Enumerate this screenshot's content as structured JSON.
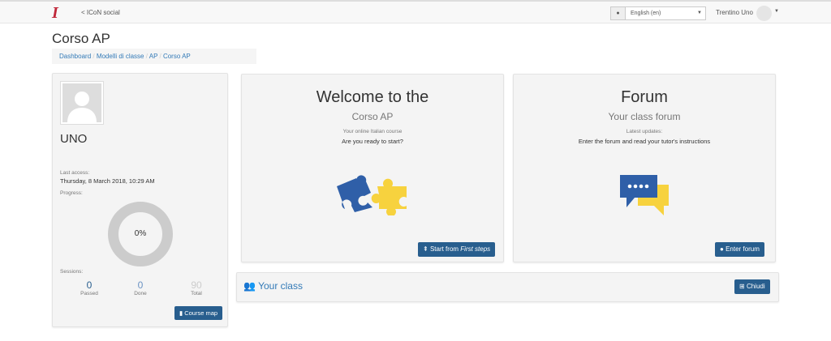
{
  "nav": {
    "logo": "I",
    "social": "ICoN social",
    "language": "English (en)",
    "user": "Trentino Uno"
  },
  "page_title": "Corso AP",
  "breadcrumb": [
    "Dashboard",
    "Modelli di classe",
    "AP",
    "Corso AP"
  ],
  "profile": {
    "name": "UNO",
    "last_access_label": "Last access:",
    "last_access": "Thursday, 8 March 2018, 10:29 AM",
    "progress_label": "Progress:",
    "progress": "0%",
    "progress_value": 0,
    "sessions_label": "Sessions:",
    "stats": [
      {
        "value": "0",
        "label": "Passed"
      },
      {
        "value": "0",
        "label": "Done"
      },
      {
        "value": "90",
        "label": "Total"
      }
    ],
    "course_map": "Course map"
  },
  "welcome": {
    "title": "Welcome to the",
    "subtitle": "Corso AP",
    "line1": "Your online Italian course",
    "line2": "Are you ready to start?",
    "button": "Start from ",
    "button_em": "First steps"
  },
  "forum": {
    "title": "Forum",
    "subtitle": "Your class forum",
    "line1": "Latest updates:",
    "line2": "Enter the forum and read your tutor's instructions",
    "button": "Enter forum"
  },
  "your_class": {
    "title": "Your class",
    "button": "Chiudi"
  },
  "colors": {
    "primary": "#285e8e",
    "link": "#337ab7",
    "puzzle_blue": "#2f5fa8",
    "puzzle_yellow": "#f7d23e"
  }
}
